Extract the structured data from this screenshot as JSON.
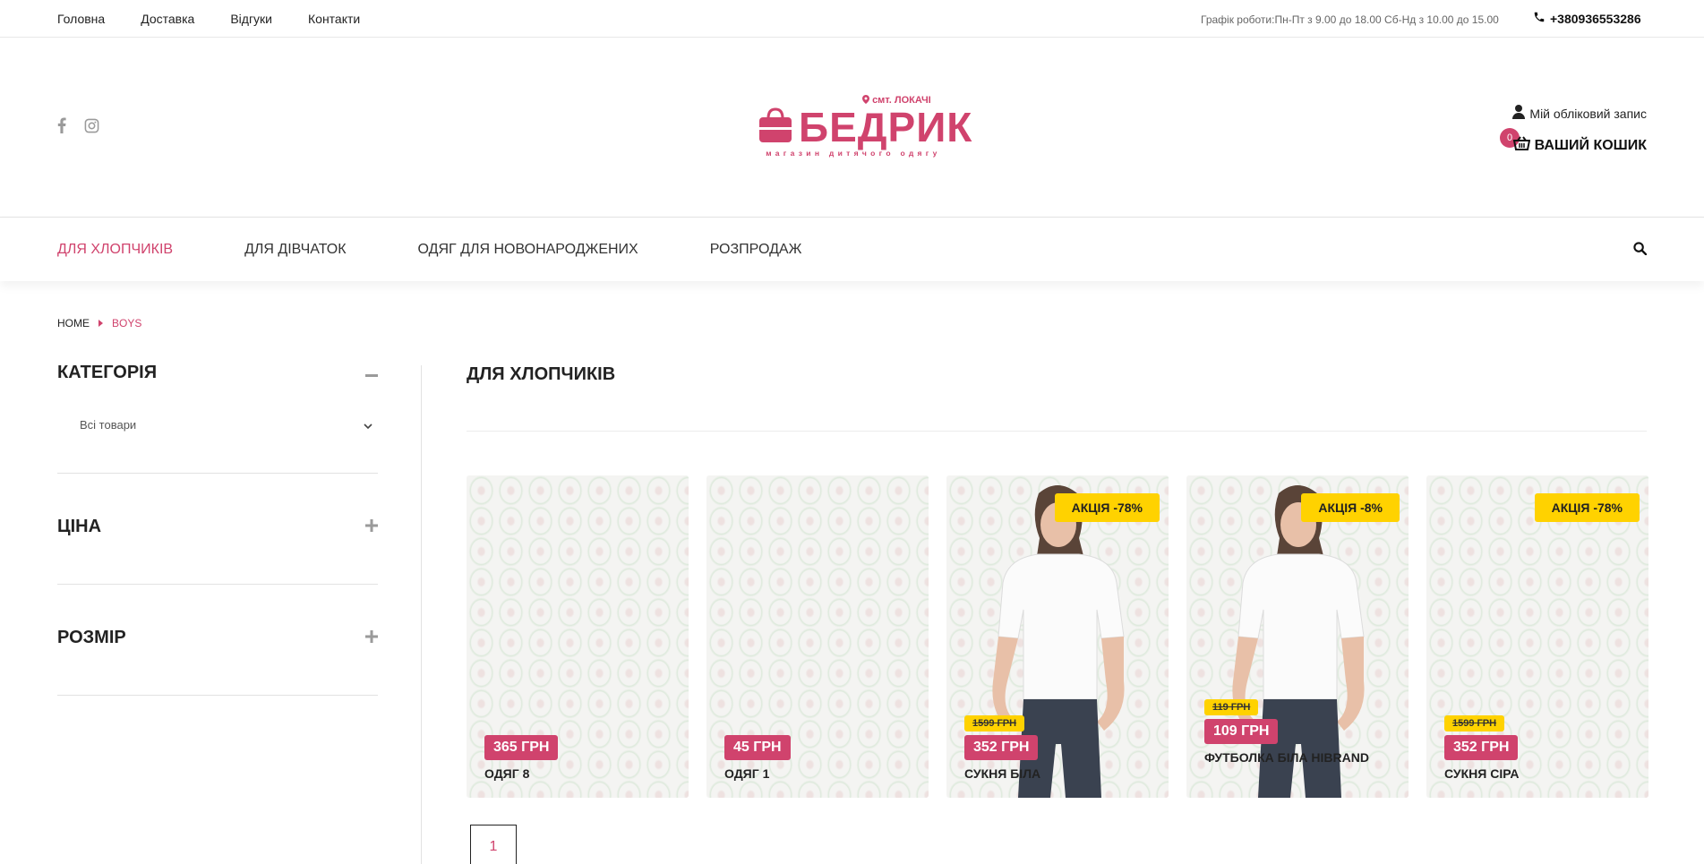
{
  "topbar": {
    "links": [
      "Головна",
      "Доставка",
      "Відгуки",
      "Контакти"
    ],
    "hours": "Графік роботи:Пн-Пт з 9.00 до 18.00 Сб-Нд з 10.00 до 15.00",
    "phone": "+380936553286"
  },
  "header": {
    "logo_location": "смт. ЛОКАЧІ",
    "logo_name": "БЕДРИК",
    "logo_tagline": "магазин дитячого одягу",
    "account_label": "Мій обліковий запис",
    "cart_label": "ВАШИЙ КОШИК",
    "cart_count": "0"
  },
  "nav": {
    "items": [
      "ДЛЯ ХЛОПЧИКІВ",
      "ДЛЯ ДІВЧАТОК",
      "ОДЯГ ДЛЯ НОВОНАРОДЖЕНИХ",
      "РОЗПРОДАЖ"
    ],
    "active_index": 0
  },
  "breadcrumb": {
    "home": "HOME",
    "current": "BOYS"
  },
  "sidebar": {
    "category_title": "КАТЕГОРІЯ",
    "category_value": "Всі товари",
    "price_title": "ЦІНА",
    "size_title": "РОЗМІР"
  },
  "content": {
    "title": "ДЛЯ ХЛОПЧИКІВ",
    "products": [
      {
        "name": "ОДЯГ 8",
        "price": "365 ГРН",
        "old_price": "",
        "sale": "",
        "has_model": false
      },
      {
        "name": "ОДЯГ 1",
        "price": "45 ГРН",
        "old_price": "",
        "sale": "",
        "has_model": false
      },
      {
        "name": "СУКНЯ БІЛА",
        "price": "352 ГРН",
        "old_price": "1599 ГРН",
        "sale": "АКЦІЯ -78%",
        "has_model": true
      },
      {
        "name": "ФУТБОЛКА БІЛА HIBRAND",
        "price": "109 ГРН",
        "old_price": "119 ГРН",
        "sale": "АКЦІЯ -8%",
        "has_model": true
      },
      {
        "name": "СУКНЯ СІРА",
        "price": "352 ГРН",
        "old_price": "1599 ГРН",
        "sale": "АКЦІЯ -78%",
        "has_model": false
      }
    ],
    "pagination": [
      "1"
    ]
  },
  "colors": {
    "accent": "#d0436d",
    "sale": "#ffd200"
  }
}
